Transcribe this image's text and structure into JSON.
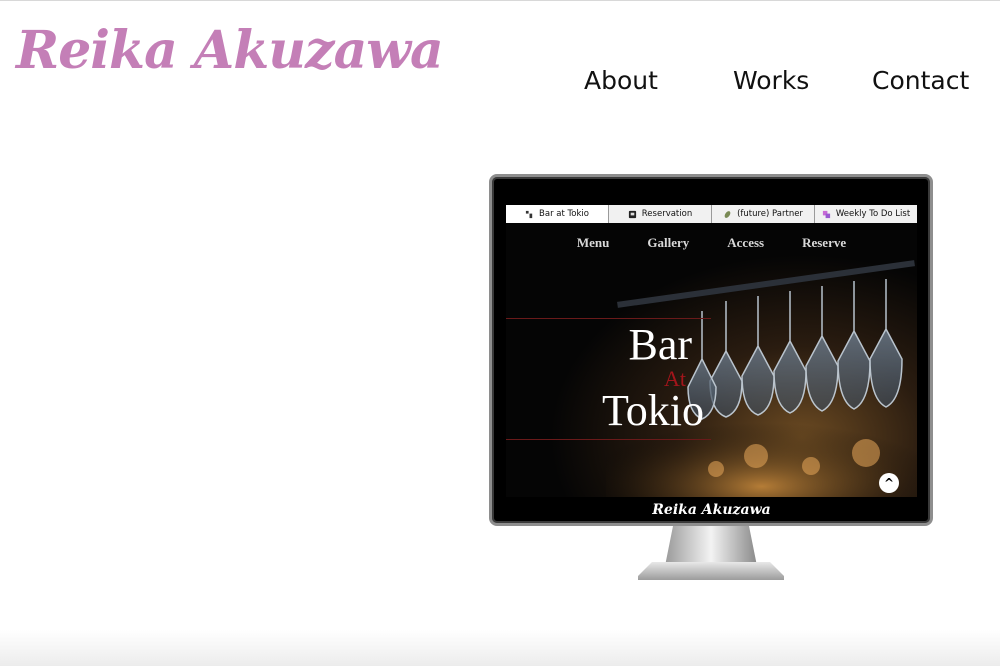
{
  "header": {
    "logo_text": "Reika Akuzawa",
    "nav": {
      "about": "About",
      "works": "Works",
      "contact": "Contact"
    }
  },
  "colors": {
    "logo": "#c47fb7",
    "text": "#111111",
    "hero_accent": "#a3151b"
  },
  "mockup": {
    "tabs": [
      {
        "label": "Bar at Tokio",
        "icon": "bar-favicon-icon"
      },
      {
        "label": "Reservation",
        "icon": "reservation-favicon-icon"
      },
      {
        "label": "(future) Partner",
        "icon": "leaf-favicon-icon"
      },
      {
        "label": "Weekly To Do List",
        "icon": "todo-favicon-icon"
      }
    ],
    "site_nav": [
      "Menu",
      "Gallery",
      "Access",
      "Reserve"
    ],
    "hero": {
      "line1": "Bar",
      "line2": "At",
      "line3": "Tokio"
    },
    "scroll_top_icon": "^",
    "footer_logo": "Reika Akuzawa"
  }
}
